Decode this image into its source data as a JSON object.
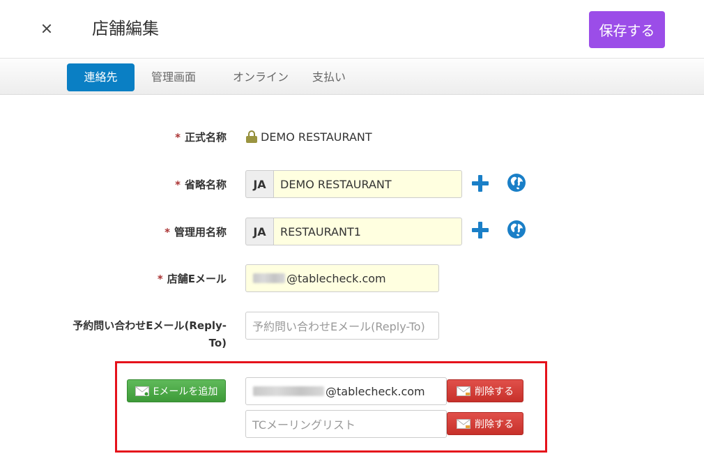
{
  "header": {
    "title": "店舗編集",
    "save_label": "保存する"
  },
  "tabs": [
    {
      "label": "連絡先",
      "active": true
    },
    {
      "label": "管理画面",
      "active": false
    },
    {
      "label": "オンライン",
      "active": false
    },
    {
      "label": "支払い",
      "active": false
    }
  ],
  "form": {
    "required_mark": "*",
    "official_name": {
      "label": "正式名称",
      "value": "DEMO RESTAURANT"
    },
    "short_name": {
      "label": "省略名称",
      "lang": "JA",
      "value": "DEMO RESTAURANT"
    },
    "admin_name": {
      "label": "管理用名称",
      "lang": "JA",
      "value": "RESTAURANT1"
    },
    "store_email": {
      "label": "店舗Eメール",
      "value": "@tablecheck.com"
    },
    "reply_to": {
      "label_line1": "予約問い合わせEメール(Reply-",
      "label_line2": "To)",
      "placeholder": "予約問い合わせEメール(Reply-To)"
    }
  },
  "extra_emails": {
    "add_label": "Eメールを追加",
    "rows": [
      {
        "value": "@tablecheck.com",
        "placeholder": "",
        "delete_label": "削除する"
      },
      {
        "value": "",
        "placeholder": "TCメーリングリスト",
        "delete_label": "削除する"
      }
    ]
  },
  "colors": {
    "save_button": "#9b4de8",
    "active_tab": "#0a7fc4",
    "input_bg": "#ffffe0",
    "add_button": "#4cae47",
    "delete_button": "#d43f3a",
    "highlight_border": "#e5121b"
  },
  "icons": [
    "close-icon",
    "lock-icon",
    "plus-icon",
    "globe-icon",
    "mail-icon"
  ]
}
